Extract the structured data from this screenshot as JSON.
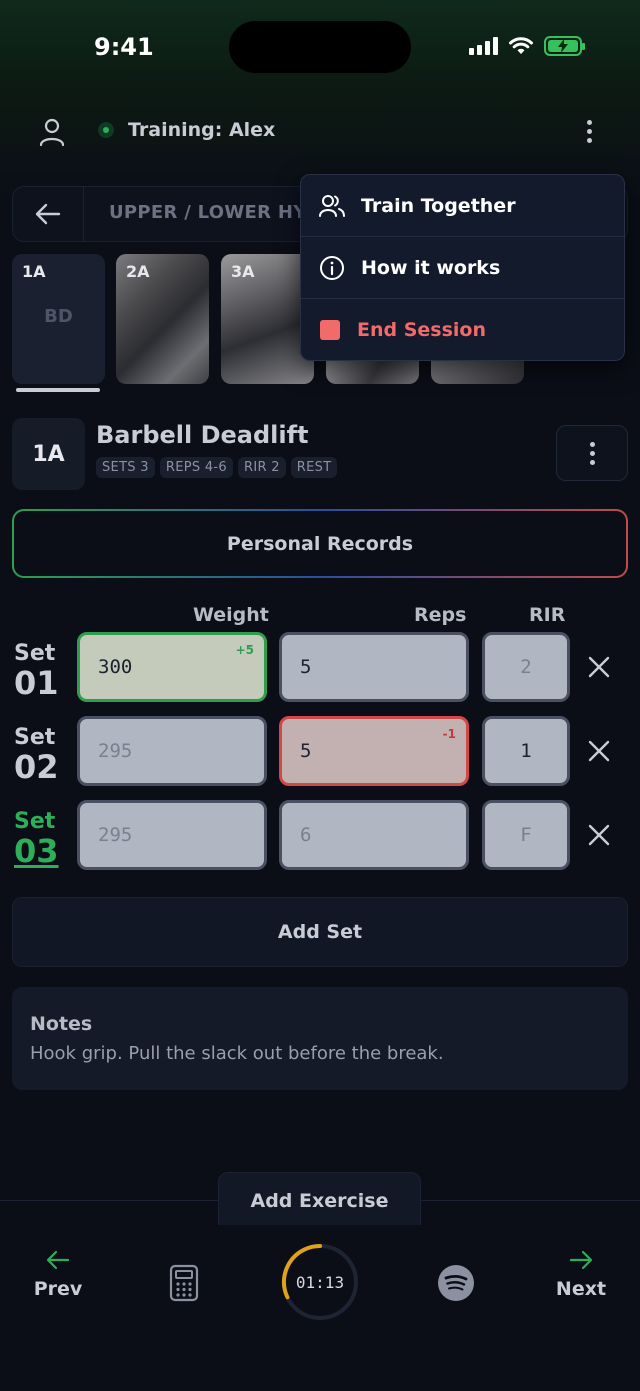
{
  "status_bar": {
    "time": "9:41"
  },
  "header": {
    "title": "Training: Alex"
  },
  "workout": {
    "name": "UPPER / LOWER HYPERTROPHY"
  },
  "thumbnails": [
    {
      "label": "1A",
      "center": "BD"
    },
    {
      "label": "2A",
      "center": ""
    },
    {
      "label": "3A",
      "center": ""
    }
  ],
  "menu": {
    "items": [
      {
        "label": "Train Together",
        "icon": "users-icon"
      },
      {
        "label": "How it works",
        "icon": "info-icon"
      },
      {
        "label": "End Session",
        "icon": "stop-icon"
      }
    ],
    "danger_color": "#f26a6a"
  },
  "exercise": {
    "code": "1A",
    "name": "Barbell Deadlift",
    "chips": [
      "SETS 3",
      "REPS 4-6",
      "RIR 2",
      "REST"
    ]
  },
  "personal_records_label": "Personal Records",
  "columns": {
    "weight": "Weight",
    "reps": "Reps",
    "rir": "RIR"
  },
  "sets": [
    {
      "prefix": "Set",
      "number": "01",
      "weight": "300",
      "weight_delta": "+5",
      "reps": "5",
      "rir": "2"
    },
    {
      "prefix": "Set",
      "number": "02",
      "weight": "295",
      "reps": "5",
      "reps_delta": "-1",
      "rir": "1"
    },
    {
      "prefix": "Set",
      "number": "03",
      "weight": "295",
      "reps": "6",
      "rir": "F"
    }
  ],
  "add_set_label": "Add Set",
  "notes": {
    "title": "Notes",
    "text": "Hook grip. Pull the slack out before the break."
  },
  "add_exercise_label": "Add Exercise",
  "bottom_nav": {
    "prev": "Prev",
    "next": "Next",
    "timer": "01:13",
    "timer_progress": 0.32
  },
  "colors": {
    "accent_green": "#2fae5a",
    "warning_red": "#d24848",
    "timer_ring": "#e0a21a"
  }
}
